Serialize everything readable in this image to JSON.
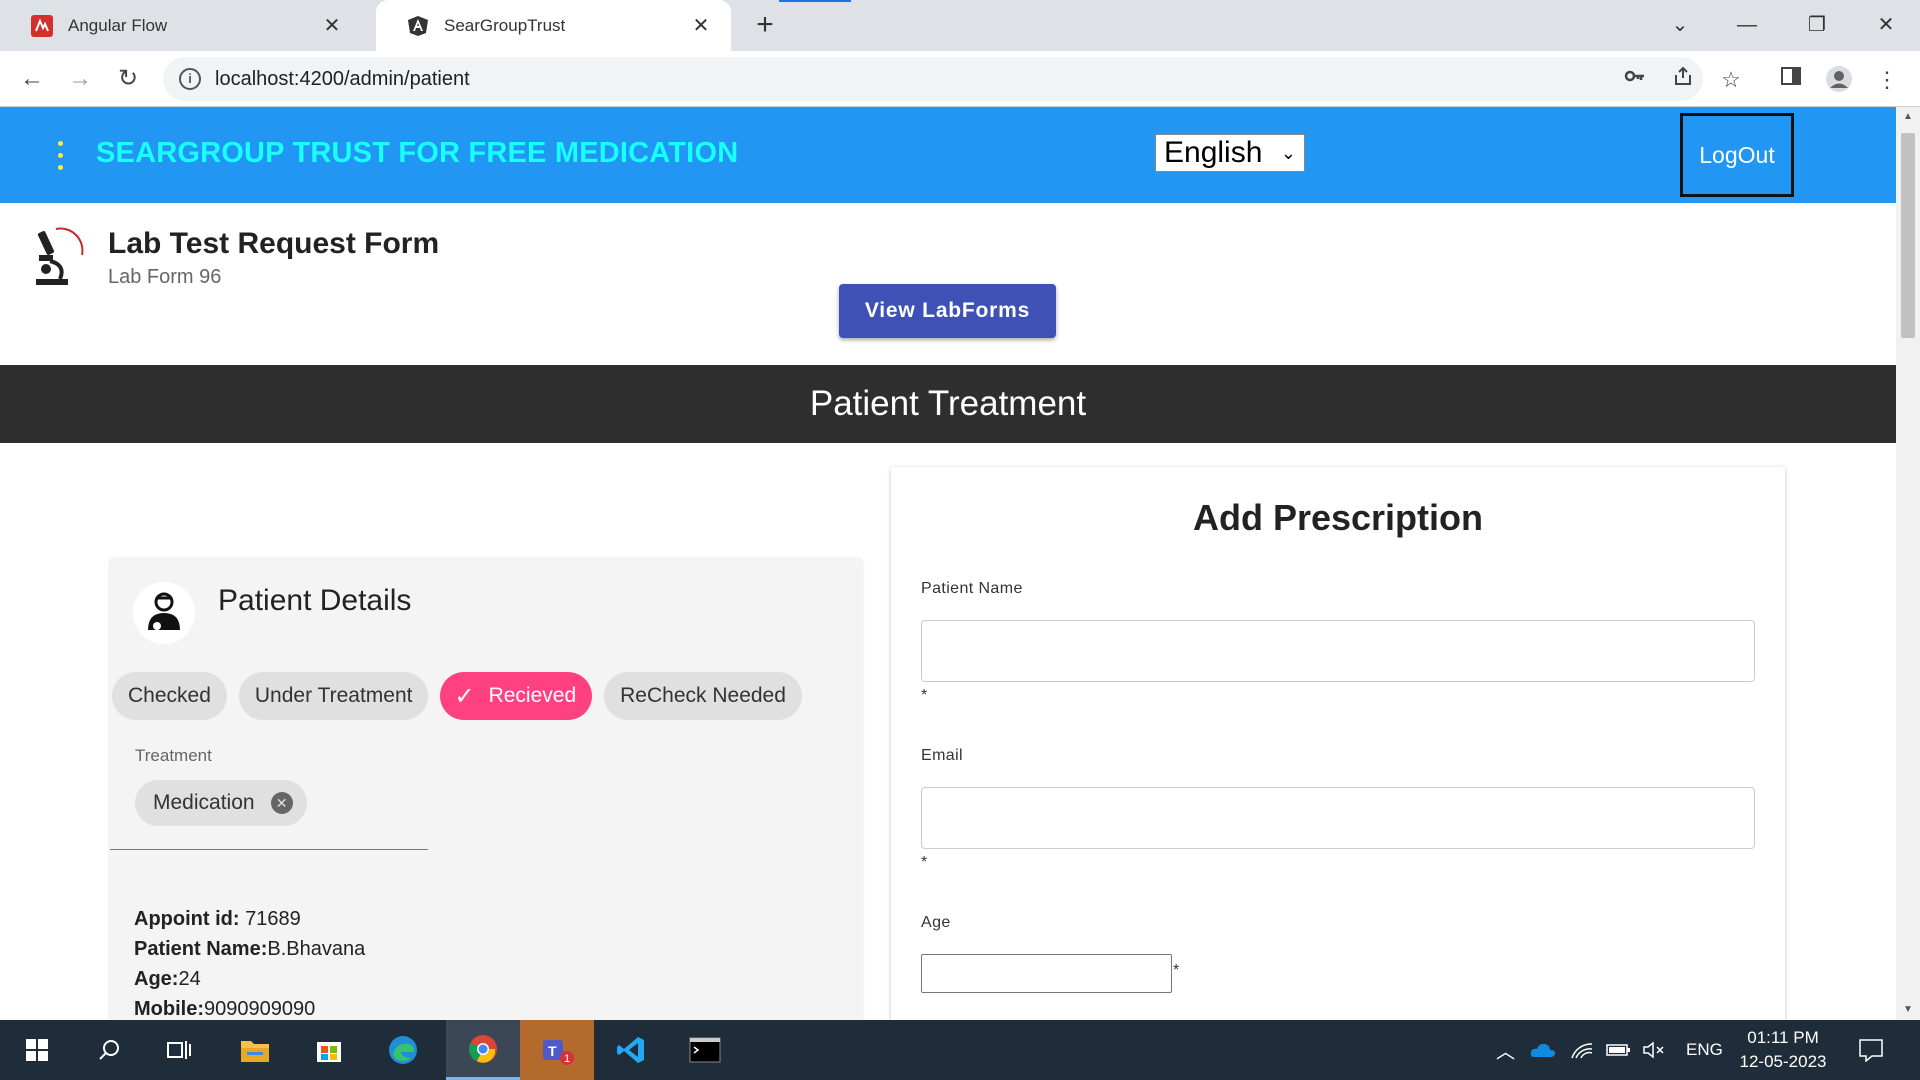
{
  "browser": {
    "tabs": [
      {
        "label": "Angular Flow",
        "active": false
      },
      {
        "label": "SearGroupTrust",
        "active": true
      }
    ],
    "new_tab": "+",
    "url": "localhost:4200/admin/patient",
    "nav": {
      "back": "←",
      "forward": "→",
      "reload": "↻"
    },
    "window": {
      "minimize": "—",
      "restore": "❐",
      "close": "✕",
      "tab_search": "⌄"
    }
  },
  "header": {
    "title": "SEARGROUP TRUST FOR FREE MEDICATION",
    "language": "English",
    "logout": "LogOut",
    "title_color": "#18ffff",
    "bar_color": "#2196f3"
  },
  "lab": {
    "title": "Lab Test Request Form",
    "subtitle": "Lab Form 96",
    "view_button": "View LabForms"
  },
  "section_title": "Patient Treatment",
  "patient_details": {
    "title": "Patient Details",
    "status_chips": [
      {
        "label": "Checked",
        "selected": false
      },
      {
        "label": "Under Treatment",
        "selected": false
      },
      {
        "label": "Recieved",
        "selected": true
      },
      {
        "label": "ReCheck Needed",
        "selected": false
      }
    ],
    "treatment_label": "Treatment",
    "treatment_chip": "Medication",
    "info": [
      {
        "label": "Appoint id:",
        "value": " 71689"
      },
      {
        "label": "Patient Name:",
        "value": "B.Bhavana"
      },
      {
        "label": "Age:",
        "value": "24"
      },
      {
        "label": "Mobile:",
        "value": "9090909090"
      }
    ]
  },
  "prescription": {
    "title": "Add Prescription",
    "fields": [
      {
        "label": "Patient Name",
        "value": "",
        "required_mark": "*"
      },
      {
        "label": "Email",
        "value": "",
        "required_mark": "*"
      },
      {
        "label": "Age",
        "value": "",
        "required_mark": "*"
      }
    ]
  },
  "taskbar": {
    "tray_lang": "ENG",
    "time": "01:11 PM",
    "date": "12-05-2023",
    "teams_badge": "1"
  }
}
